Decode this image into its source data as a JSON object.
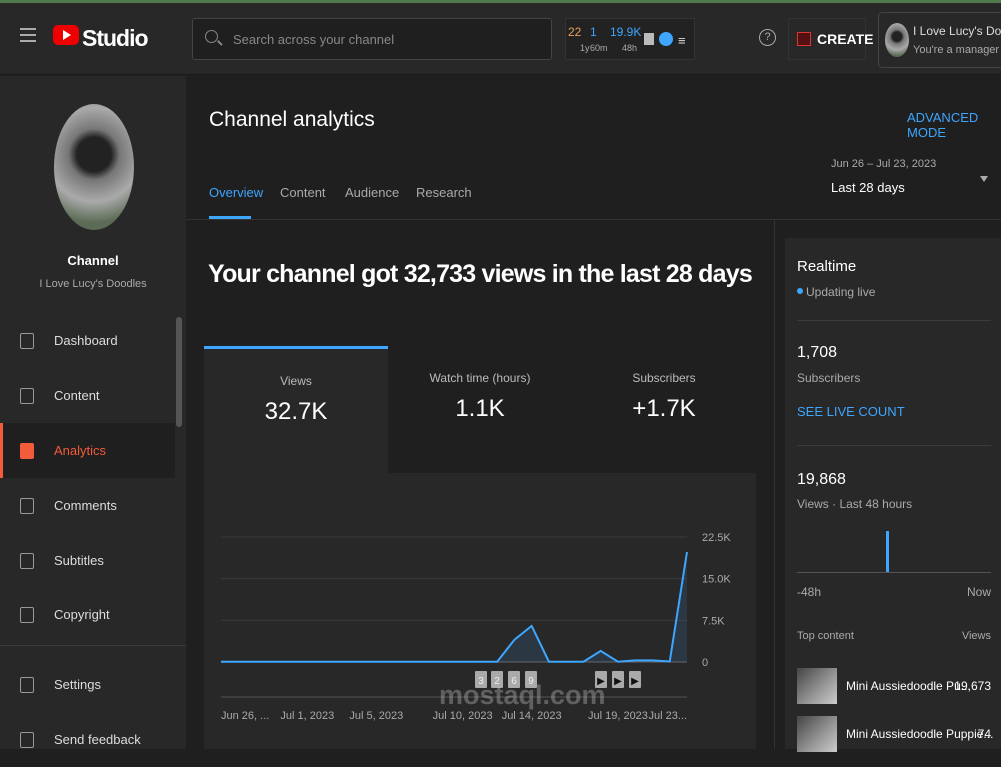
{
  "topbar": {
    "brand": "Studio",
    "search_placeholder": "Search across your channel",
    "stats": {
      "v1": "22",
      "l1": "1y",
      "v2": "1",
      "l2": "60m",
      "v3": "19.9K",
      "l3": "48h"
    },
    "create_label": "CREATE",
    "account_name": "I Love Lucy's Doodles",
    "account_role": "You're a manager"
  },
  "sidebar": {
    "channel_label": "Channel",
    "channel_name": "I Love Lucy's Doodles",
    "items": [
      {
        "label": "Dashboard",
        "icon": "dashboard-icon"
      },
      {
        "label": "Content",
        "icon": "content-icon"
      },
      {
        "label": "Analytics",
        "icon": "analytics-icon",
        "active": true
      },
      {
        "label": "Comments",
        "icon": "comments-icon"
      },
      {
        "label": "Subtitles",
        "icon": "subtitles-icon"
      },
      {
        "label": "Copyright",
        "icon": "copyright-icon"
      },
      {
        "label": "Settings",
        "icon": "gear-icon"
      },
      {
        "label": "Send feedback",
        "icon": "feedback-icon"
      }
    ]
  },
  "header": {
    "title": "Channel analytics",
    "advanced": "ADVANCED MODE",
    "tabs": [
      "Overview",
      "Content",
      "Audience",
      "Research"
    ],
    "active_tab": "Overview",
    "date_range": "Jun 26 – Jul 23, 2023",
    "period": "Last 28 days"
  },
  "headline": "Your channel got 32,733 views in the last 28 days",
  "metrics": [
    {
      "label": "Views",
      "value": "32.7K"
    },
    {
      "label": "Watch time (hours)",
      "value": "1.1K"
    },
    {
      "label": "Subscribers",
      "value": "+1.7K"
    }
  ],
  "chart_data": {
    "type": "area",
    "ylim": [
      0,
      22500
    ],
    "yticks": [
      "0",
      "7.5K",
      "15.0K",
      "22.5K"
    ],
    "xtick_labels": [
      "Jun 26, ...",
      "Jul 1, 2023",
      "Jul 5, 2023",
      "Jul 10, 2023",
      "Jul 14, 2023",
      "Jul 19, 2023",
      "Jul 23..."
    ],
    "xtick_index": [
      0,
      5,
      9,
      14,
      18,
      23,
      27
    ],
    "values": [
      50,
      50,
      50,
      50,
      50,
      50,
      50,
      50,
      50,
      50,
      50,
      50,
      50,
      50,
      50,
      50,
      50,
      4000,
      6500,
      50,
      50,
      50,
      2000,
      50,
      300,
      300,
      100,
      19800
    ],
    "markers": [
      "3",
      "2",
      "6",
      "9",
      "▶",
      "▶",
      "▶"
    ],
    "color": "#3ea6ff"
  },
  "realtime": {
    "title": "Realtime",
    "status": "Updating live",
    "subs": "1,708",
    "subs_label": "Subscribers",
    "live_link": "SEE LIVE COUNT",
    "views": "19,868",
    "views_label": "Views · Last 48 hours",
    "start": "-48h",
    "end": "Now",
    "top_label": "Top content",
    "views_col": "Views",
    "top": [
      {
        "title": "Mini Aussiedoodle Pu...",
        "views": "19,673"
      },
      {
        "title": "Mini Aussiedoodle Puppie...",
        "views": "74"
      }
    ]
  },
  "watermark": "mostaql.com"
}
